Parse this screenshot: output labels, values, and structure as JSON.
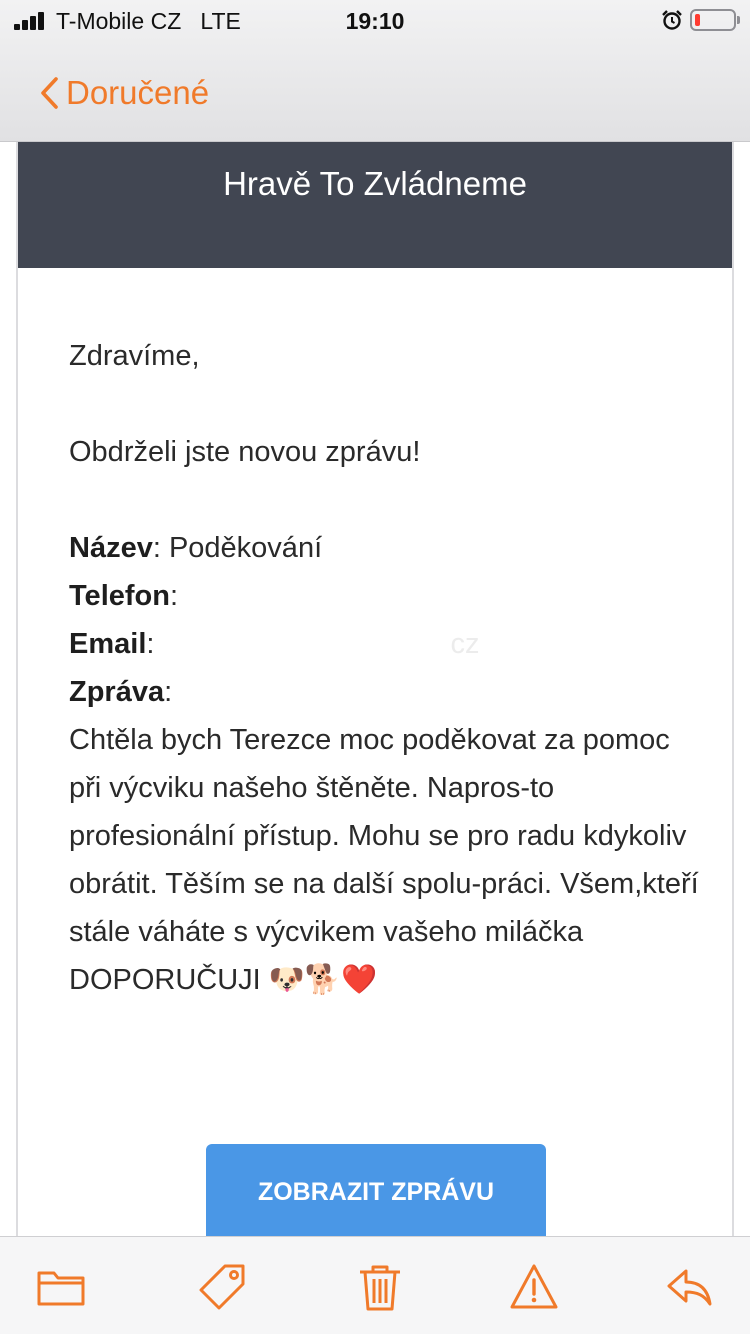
{
  "status_bar": {
    "carrier": "T-Mobile CZ",
    "network": "LTE",
    "time": "19:10",
    "signal_icon": "signal-bars-icon",
    "alarm_icon": "alarm-clock-icon",
    "battery_icon": "battery-low-icon",
    "battery_level": 0.1
  },
  "nav": {
    "back_label": "Doručené",
    "back_icon": "chevron-left-icon",
    "accent_color": "#f07a2a"
  },
  "email": {
    "header_title": "Hravě To Zvládneme",
    "header_color": "#414652",
    "greeting": "Zdravíme,",
    "intro": "Obdrželi jste novou zprávu!",
    "fields": {
      "name_label": "Název",
      "name_value": "Poděkování",
      "phone_label": "Telefon",
      "phone_value": "",
      "email_label": "Email",
      "email_value": "cz",
      "message_label": "Zpráva"
    },
    "message": "Chtěla bych Terezce moc poděkovat za pomoc při výcviku našeho štěněte. Napros-to profesionální přístup. Mohu se pro radu kdykoliv obrátit. Těším se na další spolu-práci. Všem,kteří stále váháte s výcvikem vašeho miláčka DOPORUČUJI 🐶🐕❤️",
    "cta_label": "ZOBRAZIT ZPRÁVU",
    "cta_color": "#4a97e6"
  },
  "toolbar": {
    "items": [
      {
        "icon": "folder-icon"
      },
      {
        "icon": "tag-icon"
      },
      {
        "icon": "trash-icon"
      },
      {
        "icon": "warning-icon"
      },
      {
        "icon": "reply-icon"
      }
    ]
  }
}
